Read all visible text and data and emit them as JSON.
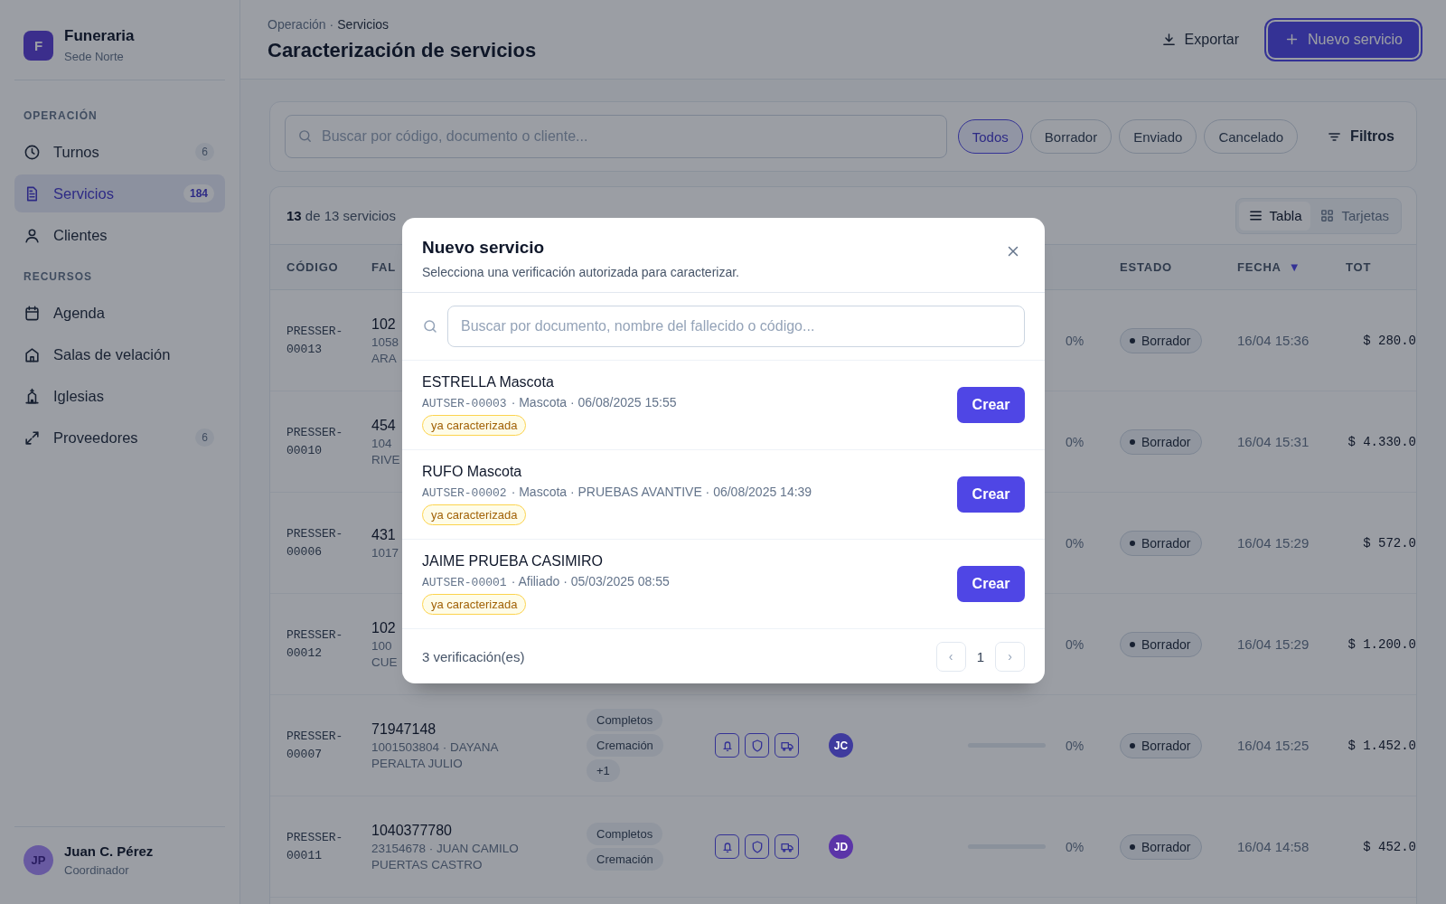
{
  "sidebar": {
    "brand": {
      "logo": "F",
      "name": "Funeraria",
      "subtitle": "Sede Norte"
    },
    "sections": [
      {
        "title": "OPERACIÓN",
        "items": [
          {
            "label": "Turnos",
            "count": "6",
            "selected": false
          },
          {
            "label": "Servicios",
            "count": "184",
            "selected": true
          },
          {
            "label": "Clientes",
            "selected": false
          }
        ]
      },
      {
        "title": "RECURSOS",
        "items": [
          {
            "label": "Agenda",
            "selected": false
          },
          {
            "label": "Salas de velación",
            "selected": false
          },
          {
            "label": "Iglesias",
            "selected": false
          },
          {
            "label": "Proveedores",
            "count": "6",
            "selected": false
          }
        ]
      }
    ],
    "user": {
      "initials": "JP",
      "name": "Juan C. Pérez",
      "role": "Coordinador"
    }
  },
  "header": {
    "breadcrumb": [
      "Operación",
      "Servicios"
    ],
    "separator": "·",
    "title": "Caracterización de servicios",
    "export_button": "Exportar",
    "new_button": {
      "label": "Nuevo servicio",
      "focused": true
    }
  },
  "filters": {
    "search": {
      "placeholder": "Buscar por código, documento o cliente..."
    },
    "chips": [
      {
        "label": "Todos",
        "selected": true
      },
      {
        "label": "Borrador",
        "selected": false
      },
      {
        "label": "Enviado",
        "selected": false
      },
      {
        "label": "Cancelado",
        "selected": false
      }
    ],
    "filters_button": "Filtros"
  },
  "table": {
    "count": "**13** de 13 servicios",
    "views": [
      {
        "label": "Tabla",
        "selected": true
      },
      {
        "label": "Tarjetas",
        "selected": false
      }
    ],
    "columns": {
      "code": "CÓDIGO",
      "deceased": "FAL",
      "status": "ESTADO",
      "date": {
        "label": "FECHA",
        "sort_indicator": "▼"
      },
      "total": "TOT"
    },
    "rows": [
      {
        "code": "PRESSER-00013",
        "doc": "102",
        "detail_lines": [
          "1058",
          "ARA"
        ],
        "progress": "0%",
        "status": "Borrador",
        "date": "16/04 15:36",
        "total": "$ 280.0"
      },
      {
        "code": "PRESSER-00010",
        "doc": "454",
        "detail_lines": [
          "104",
          "RIVE"
        ],
        "progress": "0%",
        "status": "Borrador",
        "date": "16/04 15:31",
        "total": "$ 4.330.0"
      },
      {
        "code": "PRESSER-00006",
        "doc": "431",
        "detail_lines": [
          "1017"
        ],
        "progress": "0%",
        "status": "Borrador",
        "date": "16/04 15:29",
        "total": "$ 572.0"
      },
      {
        "code": "PRESSER-00012",
        "doc": "102",
        "detail_lines": [
          "100",
          "CUE"
        ],
        "progress": "0%",
        "status": "Borrador",
        "date": "16/04 15:29",
        "total": "$ 1.200.0"
      },
      {
        "code": "PRESSER-00007",
        "doc": "71947148",
        "detail_lines": [
          "1001503804 · DAYANA",
          "PERALTA JULIO"
        ],
        "tags": [
          "Completos",
          "Cremación",
          "+1"
        ],
        "initials": "JC",
        "color": "#3f3b9e",
        "level": 0,
        "progress": "0%",
        "status": "Borrador",
        "date": "16/04 15:25",
        "total": "$ 1.452.0"
      },
      {
        "code": "PRESSER-00011",
        "doc": "1040377780",
        "detail_lines": [
          "23154678 · JUAN CAMILO",
          "PUERTAS CASTRO"
        ],
        "tags": [
          "Completos",
          "Cremación"
        ],
        "initials": "JD",
        "color": "#5b35a8",
        "level": 0,
        "progress": "0%",
        "status": "Borrador",
        "date": "16/04 14:58",
        "total": "$ 452.0"
      }
    ]
  },
  "modal": {
    "title": "Nuevo servicio",
    "subtitle": "Selecciona una verificación autorizada para caracterizar.",
    "search": {
      "placeholder": "Buscar por documento, nombre del fallecido o código..."
    },
    "items": [
      {
        "name": "ESTRELLA Mascota",
        "code": "AUTSER-00003",
        "meta": "· Mascota · 06/08/2025 15:55",
        "badge": "ya caracterizada",
        "button": "Crear"
      },
      {
        "name": "RUFO Mascota",
        "code": "AUTSER-00002",
        "meta": "· Mascota · PRUEBAS AVANTIVE · 06/08/2025 14:39",
        "badge": "ya caracterizada",
        "button": "Crear"
      },
      {
        "name": "JAIME PRUEBA CASIMIRO",
        "code": "AUTSER-00001",
        "meta": "· Afiliado · 05/03/2025 08:55",
        "badge": "ya caracterizada",
        "button": "Crear"
      }
    ],
    "footer": {
      "count": "3 verificación(es)",
      "pager": {
        "prev": "‹",
        "page": "1",
        "next": "›"
      }
    }
  }
}
